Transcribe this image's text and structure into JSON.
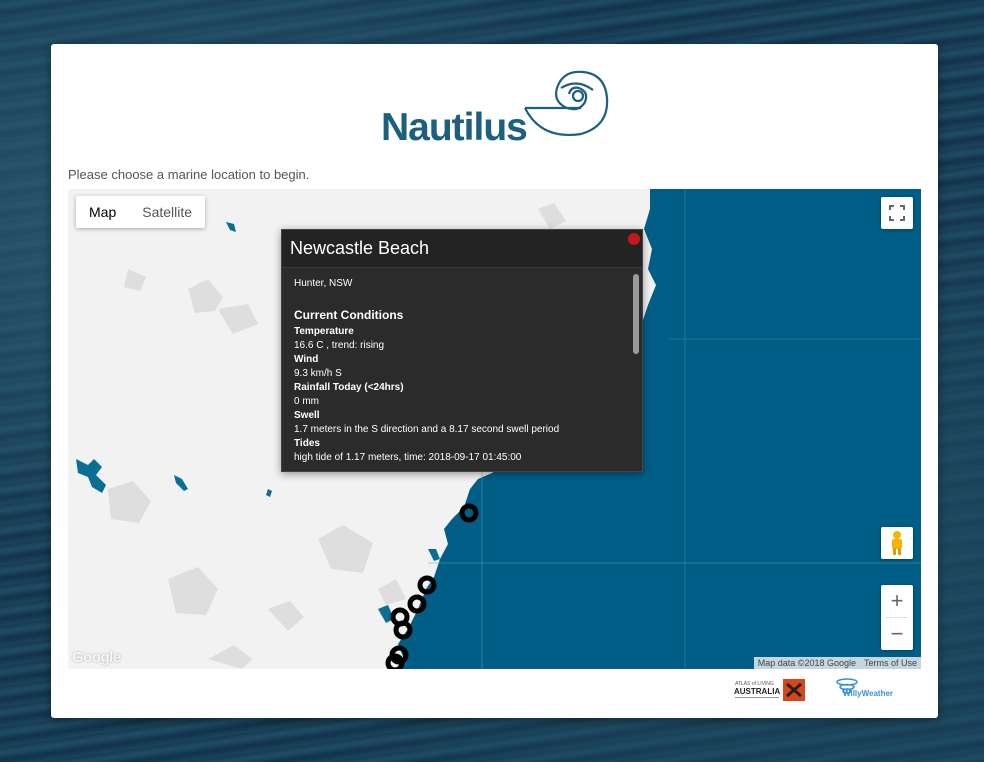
{
  "app": {
    "name": "Nautilus",
    "prompt": "Please choose a marine location to begin."
  },
  "map": {
    "type_controls": [
      "Map",
      "Satellite"
    ],
    "active_type": "Map",
    "zoom_in_label": "+",
    "zoom_out_label": "−",
    "google_label": "Google",
    "attribution": [
      "Map data ©2018 Google",
      "Terms of Use"
    ],
    "colors": {
      "ocean": "#005e86",
      "land": "#f2f2f2",
      "water": "#0b6e94"
    }
  },
  "popup": {
    "title": "Newcastle Beach",
    "location": "Hunter, NSW",
    "section": "Current Conditions",
    "fields": [
      {
        "label": "Temperature",
        "value": "16.6 C , trend: rising"
      },
      {
        "label": "Wind",
        "value": "9.3 km/h S"
      },
      {
        "label": "Rainfall Today (<24hrs)",
        "value": "0 mm"
      },
      {
        "label": "Swell",
        "value": "1.7 meters in the S direction and a 8.17 second swell period"
      },
      {
        "label": "Tides",
        "value": "high tide of 1.17 meters, time: 2018-09-17 01:45:00"
      }
    ]
  },
  "footer": {
    "ala_label": "ATLAS of LIVING AUSTRALIA",
    "ww_label": "WillyWeather"
  }
}
